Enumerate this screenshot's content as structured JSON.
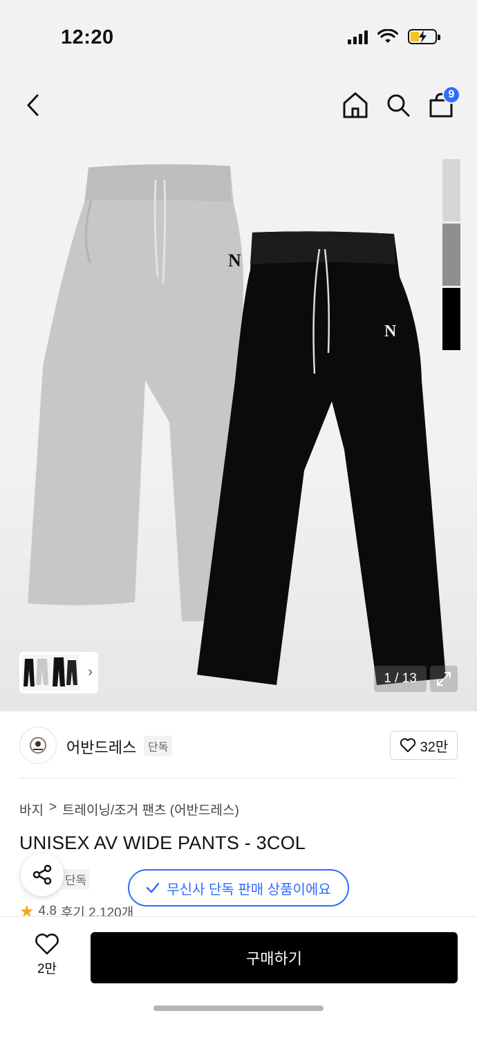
{
  "status_bar": {
    "time": "12:20"
  },
  "header": {
    "cart_count": "9"
  },
  "gallery": {
    "counter": "1 / 13",
    "swatch_colors": [
      "#d6d6d6",
      "#8f8f8f",
      "#000000"
    ]
  },
  "brand": {
    "name": "어반드레스",
    "tag": "단독",
    "likes": "32만"
  },
  "breadcrumb": {
    "category": "바지",
    "separator": ">",
    "subcategory": "트레이닝/조거 팬츠 (어반드레스)"
  },
  "product": {
    "title": "UNISEX AV WIDE PANTS - 3COL",
    "partial_tag": "단독",
    "exclusive_notice": "무신사 단독 판매 상품이에요",
    "rating": "4.8",
    "reviews": "후기 2,120개"
  },
  "bottom_bar": {
    "wish_count": "2만",
    "buy_label": "구매하기"
  }
}
